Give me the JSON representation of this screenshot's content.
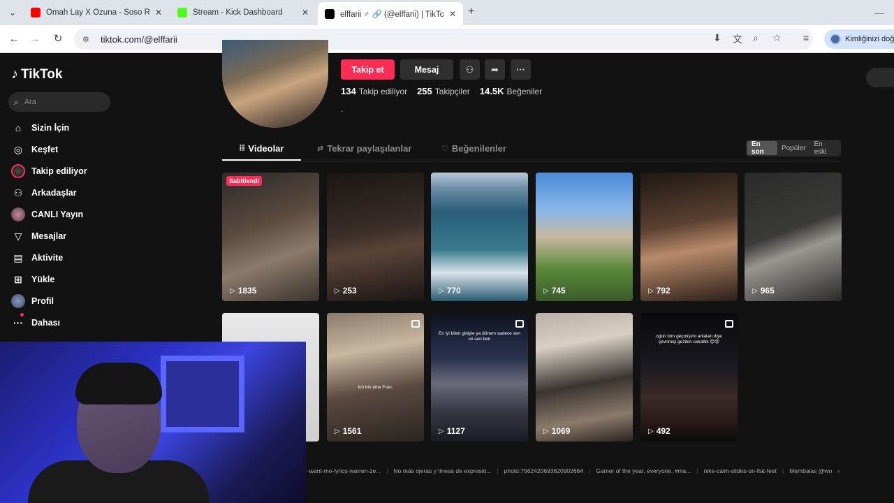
{
  "browser": {
    "tabs": [
      {
        "title": "Omah Lay X Ozuna - Soso Remi",
        "favicon_color": "#ff0000"
      },
      {
        "title": "Stream - Kick Dashboard",
        "favicon_color": "#53fc18"
      },
      {
        "title": "elffarii ♂ 🔗 (@elffarii) | TikTok",
        "favicon_color": "#000000"
      }
    ],
    "url": "tiktok.com/@elffarii",
    "profile_label": "Kimliğinizi doğr"
  },
  "sidebar": {
    "logo": "TikTok",
    "search_placeholder": "Ara",
    "items": [
      {
        "label": "Sizin İçin",
        "icon": "home-icon"
      },
      {
        "label": "Keşfet",
        "icon": "compass-icon"
      },
      {
        "label": "Takip ediliyor",
        "icon": "following-avatar"
      },
      {
        "label": "Arkadaşlar",
        "icon": "friends-icon"
      },
      {
        "label": "CANLI Yayın",
        "icon": "live-avatar"
      },
      {
        "label": "Mesajlar",
        "icon": "messages-icon"
      },
      {
        "label": "Aktivite",
        "icon": "activity-icon"
      },
      {
        "label": "Yükle",
        "icon": "upload-icon"
      },
      {
        "label": "Profil",
        "icon": "profile-avatar"
      },
      {
        "label": "Dahası",
        "icon": "more-icon"
      }
    ]
  },
  "profile": {
    "follow_label": "Takip et",
    "message_label": "Mesaj",
    "following_count": "134",
    "following_label": "Takip ediliyor",
    "followers_count": "255",
    "followers_label": "Takipçiler",
    "likes_count": "14.5K",
    "likes_label": "Beğeniler",
    "bio": "."
  },
  "tabs": {
    "videos": "Videolar",
    "reposts": "Tekrar paylaşılanlar",
    "liked": "Beğenilenler"
  },
  "sort": {
    "latest": "En son",
    "popular": "Popüler",
    "oldest": "En eski"
  },
  "videos": [
    {
      "views": "1835",
      "pinned": "Sabitlendi"
    },
    {
      "views": "253"
    },
    {
      "views": "770"
    },
    {
      "views": "745"
    },
    {
      "views": "792"
    },
    {
      "views": "965"
    },
    {
      "views": ""
    },
    {
      "views": "1561",
      "caption": "Ich bin eine Frau.",
      "multi": true
    },
    {
      "views": "1127",
      "caption": "En iyi bilen gibiyle ya dönem sadece sen ve sen ben",
      "multi": true
    },
    {
      "views": "1069"
    },
    {
      "views": "492",
      "caption": "ogün tüm geçmişimi anlatan diye çevrimiçi gezilen cekattik 😊😝",
      "multi": true
    }
  ],
  "footer": {
    "tags": [
      "-want-me-lyrics-warren-ze...",
      "No más ojeras y líneas de expresió...",
      "photo:7562420693820902664",
      "Gamer of the year, everyone. #ma...",
      "nike-calm-slides-on-flat-feet",
      "Membalas @wo"
    ]
  }
}
